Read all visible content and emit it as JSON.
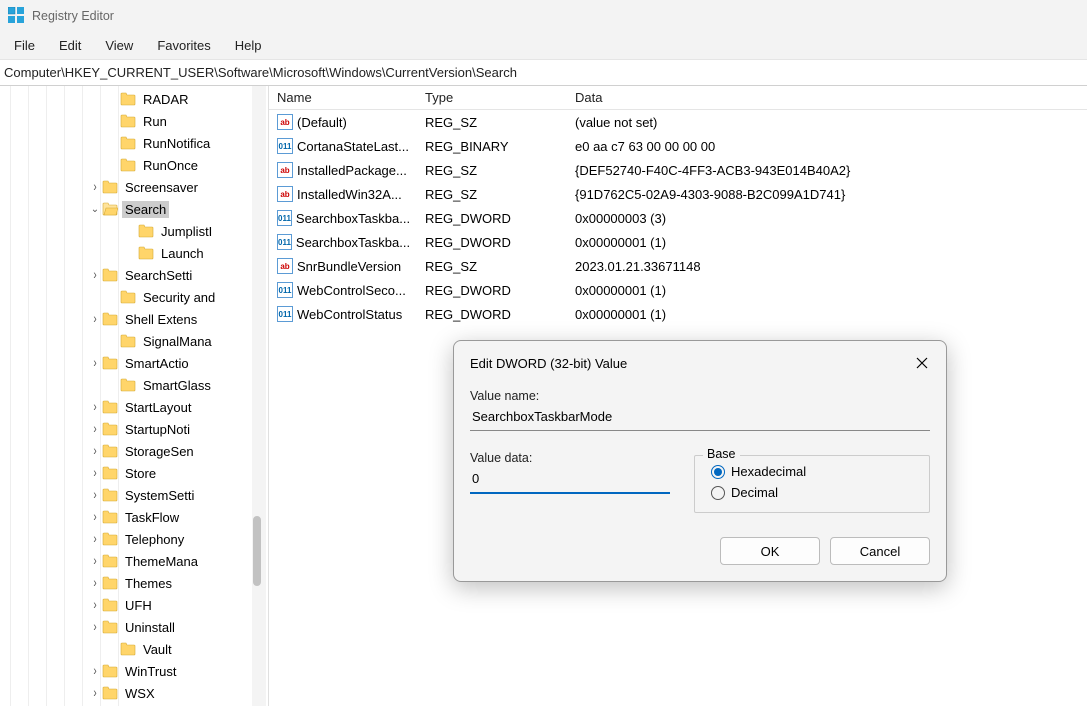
{
  "app": {
    "title": "Registry Editor"
  },
  "menu": {
    "file": "File",
    "edit": "Edit",
    "view": "View",
    "favorites": "Favorites",
    "help": "Help"
  },
  "address": "Computer\\HKEY_CURRENT_USER\\Software\\Microsoft\\Windows\\CurrentVersion\\Search",
  "tree": [
    {
      "indent": 6,
      "twisty": "",
      "label": "RADAR"
    },
    {
      "indent": 6,
      "twisty": "",
      "label": "Run"
    },
    {
      "indent": 6,
      "twisty": "",
      "label": "RunNotifica"
    },
    {
      "indent": 6,
      "twisty": "",
      "label": "RunOnce"
    },
    {
      "indent": 5,
      "twisty": ">",
      "label": "Screensaver"
    },
    {
      "indent": 5,
      "twisty": "v",
      "label": "Search",
      "selected": true
    },
    {
      "indent": 7,
      "twisty": "",
      "label": "JumplistI"
    },
    {
      "indent": 7,
      "twisty": "",
      "label": "Launch"
    },
    {
      "indent": 5,
      "twisty": ">",
      "label": "SearchSetti"
    },
    {
      "indent": 6,
      "twisty": "",
      "label": "Security and"
    },
    {
      "indent": 5,
      "twisty": ">",
      "label": "Shell Extens"
    },
    {
      "indent": 6,
      "twisty": "",
      "label": "SignalMana"
    },
    {
      "indent": 5,
      "twisty": ">",
      "label": "SmartActio"
    },
    {
      "indent": 6,
      "twisty": "",
      "label": "SmartGlass"
    },
    {
      "indent": 5,
      "twisty": ">",
      "label": "StartLayout"
    },
    {
      "indent": 5,
      "twisty": ">",
      "label": "StartupNoti"
    },
    {
      "indent": 5,
      "twisty": ">",
      "label": "StorageSen"
    },
    {
      "indent": 5,
      "twisty": ">",
      "label": "Store"
    },
    {
      "indent": 5,
      "twisty": ">",
      "label": "SystemSetti"
    },
    {
      "indent": 5,
      "twisty": ">",
      "label": "TaskFlow"
    },
    {
      "indent": 5,
      "twisty": ">",
      "label": "Telephony"
    },
    {
      "indent": 5,
      "twisty": ">",
      "label": "ThemeMana"
    },
    {
      "indent": 5,
      "twisty": ">",
      "label": "Themes"
    },
    {
      "indent": 5,
      "twisty": ">",
      "label": "UFH"
    },
    {
      "indent": 5,
      "twisty": ">",
      "label": "Uninstall"
    },
    {
      "indent": 6,
      "twisty": "",
      "label": "Vault"
    },
    {
      "indent": 5,
      "twisty": ">",
      "label": "WinTrust"
    },
    {
      "indent": 5,
      "twisty": ">",
      "label": "WSX"
    }
  ],
  "grid": {
    "cols": {
      "name": "Name",
      "type": "Type",
      "data": "Data"
    },
    "rows": [
      {
        "icon": "str",
        "name": "(Default)",
        "type": "REG_SZ",
        "data": "(value not set)"
      },
      {
        "icon": "bin",
        "name": "CortanaStateLast...",
        "type": "REG_BINARY",
        "data": "e0 aa c7 63 00 00 00 00"
      },
      {
        "icon": "str",
        "name": "InstalledPackage...",
        "type": "REG_SZ",
        "data": "{DEF52740-F40C-4FF3-ACB3-943E014B40A2}"
      },
      {
        "icon": "str",
        "name": "InstalledWin32A...",
        "type": "REG_SZ",
        "data": "{91D762C5-02A9-4303-9088-B2C099A1D741}"
      },
      {
        "icon": "bin",
        "name": "SearchboxTaskba...",
        "type": "REG_DWORD",
        "data": "0x00000003 (3)"
      },
      {
        "icon": "bin",
        "name": "SearchboxTaskba...",
        "type": "REG_DWORD",
        "data": "0x00000001 (1)"
      },
      {
        "icon": "str",
        "name": "SnrBundleVersion",
        "type": "REG_SZ",
        "data": "2023.01.21.33671148"
      },
      {
        "icon": "bin",
        "name": "WebControlSeco...",
        "type": "REG_DWORD",
        "data": "0x00000001 (1)"
      },
      {
        "icon": "bin",
        "name": "WebControlStatus",
        "type": "REG_DWORD",
        "data": "0x00000001 (1)"
      }
    ]
  },
  "dialog": {
    "title": "Edit DWORD (32-bit) Value",
    "value_name_label": "Value name:",
    "value_name": "SearchboxTaskbarMode",
    "value_data_label": "Value data:",
    "value_data": "0",
    "base_label": "Base",
    "hex_label": "Hexadecimal",
    "dec_label": "Decimal",
    "base_selected": "hex",
    "ok": "OK",
    "cancel": "Cancel"
  }
}
